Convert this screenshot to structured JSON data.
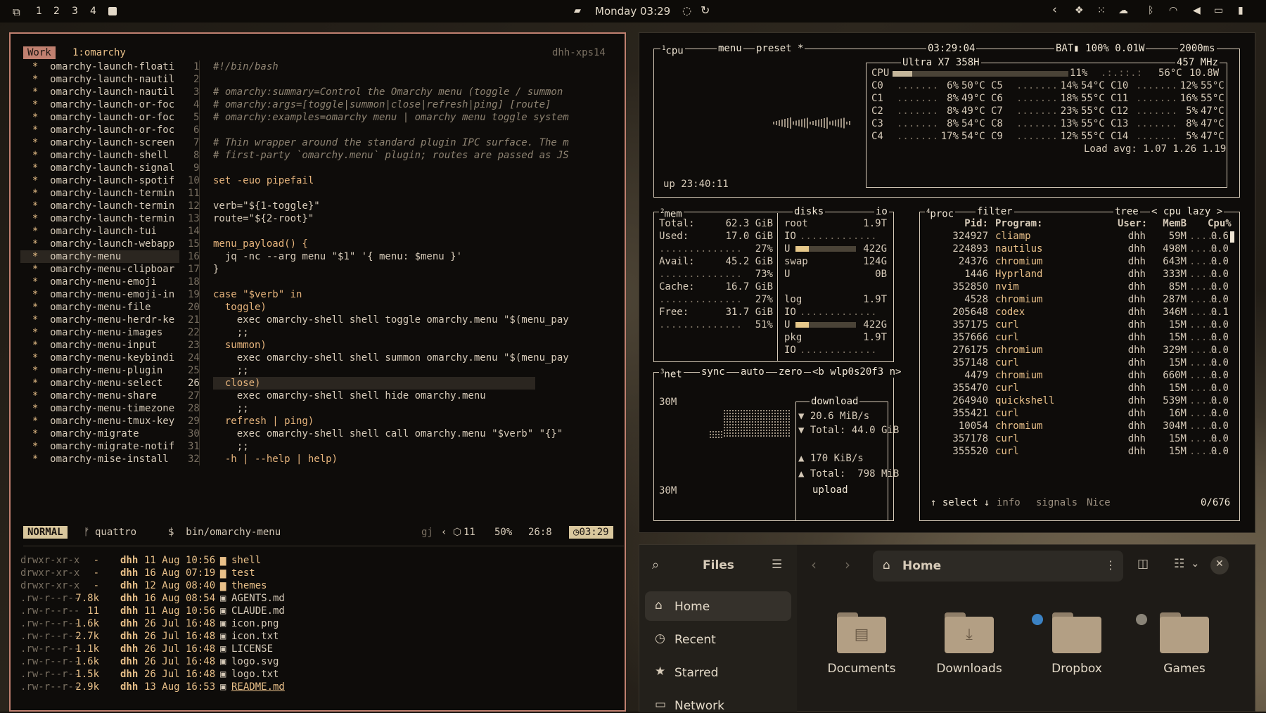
{
  "topbar": {
    "workspaces": [
      "1",
      "2",
      "3",
      "4"
    ],
    "clock": "Monday 03:29"
  },
  "editor": {
    "workspace_badge": "Work",
    "tab_label": "1:omarchy",
    "host": "dhh-xps14",
    "files": [
      "omarchy-launch-floati",
      "omarchy-launch-nautil",
      "omarchy-launch-nautil",
      "omarchy-launch-or-foc",
      "omarchy-launch-or-foc",
      "omarchy-launch-or-foc",
      "omarchy-launch-screen",
      "omarchy-launch-shell",
      "omarchy-launch-signal",
      "omarchy-launch-spotif",
      "omarchy-launch-termin",
      "omarchy-launch-termin",
      "omarchy-launch-termin",
      "omarchy-launch-tui",
      "omarchy-launch-webapp",
      "omarchy-menu",
      "omarchy-menu-clipboar",
      "omarchy-menu-emoji",
      "omarchy-menu-emoji-in",
      "omarchy-menu-file",
      "omarchy-menu-herdr-ke",
      "omarchy-menu-images",
      "omarchy-menu-input",
      "omarchy-menu-keybindi",
      "omarchy-menu-plugin",
      "omarchy-menu-select",
      "omarchy-menu-share",
      "omarchy-menu-timezone",
      "omarchy-menu-tmux-key",
      "omarchy-migrate",
      "omarchy-migrate-notif",
      "omarchy-mise-install"
    ],
    "lines": [
      "#!/bin/bash",
      "",
      "# omarchy:summary=Control the Omarchy menu (toggle / summon",
      "# omarchy:args=[toggle|summon|close|refresh|ping] [route]",
      "# omarchy:examples=omarchy menu | omarchy menu toggle system",
      "",
      "# Thin wrapper around the standard plugin IPC surface. The m",
      "# first-party `omarchy.menu` plugin; routes are passed as JS",
      "",
      "set -euo pipefail",
      "",
      "verb=\"${1-toggle}\"",
      "route=\"${2-root}\"",
      "",
      "menu_payload() {",
      "  jq -nc --arg menu \"$1\" '{ menu: $menu }'",
      "}",
      "",
      "case \"$verb\" in",
      "  toggle)",
      "    exec omarchy-shell shell toggle omarchy.menu \"$(menu_pay",
      "    ;;",
      "  summon)",
      "    exec omarchy-shell shell summon omarchy.menu \"$(menu_pay",
      "    ;;",
      "  close)",
      "    exec omarchy-shell shell hide omarchy.menu",
      "    ;;",
      "  refresh | ping)",
      "    exec omarchy-shell shell call omarchy.menu \"$verb\" \"{}\"",
      "    ;;",
      "  -h | --help | help)"
    ],
    "status": {
      "mode": "NORMAL",
      "branch": "quattro",
      "path": "$  bin/omarchy-menu",
      "extra": "gj",
      "count": "11",
      "percent": "50%",
      "position": "26:8",
      "time": "03:29"
    },
    "listing": [
      {
        "perm": "drwxr-xr-x",
        "size": "-",
        "user": "dhh",
        "date": "11 Aug 10:56",
        "name": "shell"
      },
      {
        "perm": "drwxr-xr-x",
        "size": "-",
        "user": "dhh",
        "date": "16 Aug 07:19",
        "name": "test"
      },
      {
        "perm": "drwxr-xr-x",
        "size": "-",
        "user": "dhh",
        "date": "12 Aug 08:40",
        "name": "themes"
      },
      {
        "perm": ".rw-r--r--",
        "size": "7.8k",
        "user": "dhh",
        "date": "16 Aug 08:54",
        "name": "AGENTS.md"
      },
      {
        "perm": ".rw-r--r--",
        "size": "11",
        "user": "dhh",
        "date": "11 Aug 10:56",
        "name": "CLAUDE.md"
      },
      {
        "perm": ".rw-r--r--",
        "size": "1.6k",
        "user": "dhh",
        "date": "26 Jul 16:48",
        "name": "icon.png"
      },
      {
        "perm": ".rw-r--r--",
        "size": "2.7k",
        "user": "dhh",
        "date": "26 Jul 16:48",
        "name": "icon.txt"
      },
      {
        "perm": ".rw-r--r--",
        "size": "1.1k",
        "user": "dhh",
        "date": "26 Jul 16:48",
        "name": "LICENSE"
      },
      {
        "perm": ".rw-r--r--",
        "size": "1.6k",
        "user": "dhh",
        "date": "26 Jul 16:48",
        "name": "logo.svg"
      },
      {
        "perm": ".rw-r--r--",
        "size": "1.5k",
        "user": "dhh",
        "date": "26 Jul 16:48",
        "name": "logo.txt"
      },
      {
        "perm": ".rw-r--r--",
        "size": "2.9k",
        "user": "dhh",
        "date": "13 Aug 16:53",
        "name": "README.md"
      }
    ]
  },
  "btop": {
    "cpu": {
      "labels": [
        "cpu",
        "menu",
        "preset *"
      ],
      "time": "03:29:04",
      "battery": "BAT▮ 100% 0.01W",
      "interval": "2000ms",
      "model": "Ultra X7 358H",
      "mhz": "457 MHz",
      "total": {
        "label": "CPU",
        "pct": "11%",
        "temp": "56°C",
        "watt": "10.8W",
        "fill": 0.11
      },
      "cores": [
        [
          {
            "n": "C0",
            "p": "6%",
            "t": "50°C"
          },
          {
            "n": "C5",
            "p": "14%",
            "t": "54°C"
          },
          {
            "n": "C10",
            "p": "12%",
            "t": "55°C"
          }
        ],
        [
          {
            "n": "C1",
            "p": "8%",
            "t": "49°C"
          },
          {
            "n": "C6",
            "p": "18%",
            "t": "55°C"
          },
          {
            "n": "C11",
            "p": "16%",
            "t": "55°C"
          }
        ],
        [
          {
            "n": "C2",
            "p": "8%",
            "t": "49°C"
          },
          {
            "n": "C7",
            "p": "23%",
            "t": "55°C"
          },
          {
            "n": "C12",
            "p": "5%",
            "t": "47°C"
          }
        ],
        [
          {
            "n": "C3",
            "p": "8%",
            "t": "54°C"
          },
          {
            "n": "C8",
            "p": "13%",
            "t": "55°C"
          },
          {
            "n": "C13",
            "p": "8%",
            "t": "47°C"
          }
        ],
        [
          {
            "n": "C4",
            "p": "17%",
            "t": "54°C"
          },
          {
            "n": "C9",
            "p": "12%",
            "t": "55°C"
          },
          {
            "n": "C14",
            "p": "5%",
            "t": "47°C"
          }
        ]
      ],
      "load": "Load avg: 1.07 1.26 1.19",
      "uptime": "up 23:40:11"
    },
    "mem": {
      "label": "mem",
      "rows": [
        {
          "k": "Total:",
          "v": "62.3 GiB"
        },
        {
          "k": "Used:",
          "v": "17.0 GiB",
          "pct": "27%"
        },
        {
          "k": "Avail:",
          "v": "45.2 GiB",
          "pct": "73%"
        },
        {
          "k": "Cache:",
          "v": "16.7 GiB",
          "pct": "27%"
        },
        {
          "k": "Free:",
          "v": "31.7 GiB",
          "pct": "51%"
        }
      ]
    },
    "disks": {
      "label": "disks",
      "io": "io",
      "items": [
        {
          "name": "root",
          "size": "1.9T",
          "used": "U",
          "free": "422G",
          "fill": 0.22
        },
        {
          "name": "swap",
          "size": "124G",
          "used": "U",
          "free": "0B",
          "fill": 0.0
        },
        {
          "name": "log",
          "size": "1.9T",
          "used": "U",
          "free": "422G",
          "fill": 0.22
        },
        {
          "name": "pkg",
          "size": "1.9T"
        }
      ],
      "io_label": "IO"
    },
    "net": {
      "labels": [
        "net",
        "sync",
        "auto",
        "zero"
      ],
      "iface": "<b wlp0s20f3 n>",
      "scale_top": "30M",
      "scale_bottom": "30M",
      "download": "download",
      "down_rate": "▼ 20.6 MiB/s",
      "down_total": "▼ Total: 44.0 GiB",
      "up_rate": "▲ 170 KiB/s",
      "up_total": "▲ Total:  798 MiB",
      "upload": "upload"
    },
    "proc": {
      "labels": [
        "proc",
        "filter",
        "tree",
        "< cpu lazy >"
      ],
      "headers": [
        "Pid:",
        "Program:",
        "User:",
        "MemB",
        "Cpu%"
      ],
      "rows": [
        [
          "324927",
          "cliamp",
          "dhh",
          "59M",
          "0.6"
        ],
        [
          "224893",
          "nautilus",
          "dhh",
          "498M",
          "0.0"
        ],
        [
          "24376",
          "chromium",
          "dhh",
          "643M",
          "0.0"
        ],
        [
          "1446",
          "Hyprland",
          "dhh",
          "333M",
          "0.0"
        ],
        [
          "352850",
          "nvim",
          "dhh",
          "85M",
          "0.0"
        ],
        [
          "4528",
          "chromium",
          "dhh",
          "287M",
          "0.0"
        ],
        [
          "205648",
          "codex",
          "dhh",
          "346M",
          "0.1"
        ],
        [
          "357175",
          "curl",
          "dhh",
          "15M",
          "0.0"
        ],
        [
          "357666",
          "curl",
          "dhh",
          "15M",
          "0.0"
        ],
        [
          "276175",
          "chromium",
          "dhh",
          "329M",
          "0.0"
        ],
        [
          "357148",
          "curl",
          "dhh",
          "15M",
          "0.0"
        ],
        [
          "4479",
          "chromium",
          "dhh",
          "660M",
          "0.0"
        ],
        [
          "355470",
          "curl",
          "dhh",
          "15M",
          "0.0"
        ],
        [
          "264940",
          "quickshell",
          "dhh",
          "539M",
          "0.0"
        ],
        [
          "355421",
          "curl",
          "dhh",
          "16M",
          "0.0"
        ],
        [
          "10054",
          "chromium",
          "dhh",
          "304M",
          "0.0"
        ],
        [
          "357178",
          "curl",
          "dhh",
          "15M",
          "0.0"
        ],
        [
          "355520",
          "curl",
          "dhh",
          "15M",
          "0.0"
        ]
      ],
      "footer": [
        "↑ select ↓",
        "info",
        "signals",
        "Nice"
      ],
      "count": "0/676"
    }
  },
  "files": {
    "title": "Files",
    "location": "Home",
    "sidebar": [
      "Home",
      "Recent",
      "Starred",
      "Network"
    ],
    "folders": [
      "Documents",
      "Downloads",
      "Dropbox",
      "Games"
    ]
  }
}
